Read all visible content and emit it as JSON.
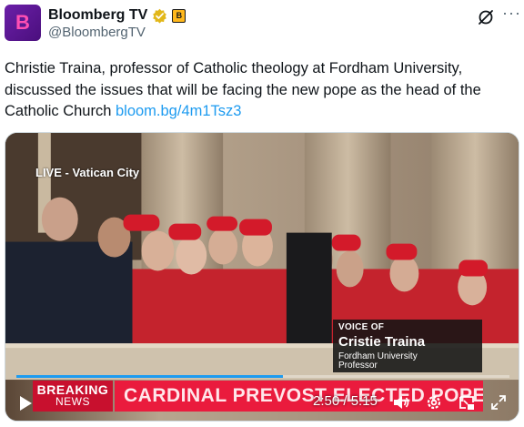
{
  "account": {
    "avatar_letter": "B",
    "display_name": "Bloomberg TV",
    "handle": "@BloombergTV",
    "affiliate_badge": "B",
    "brand_color": "#6b1fa8"
  },
  "tweet": {
    "text": "Christie Traina, professor of Catholic theology at Fordham University, discussed the issues that will be facing the new pope as the head of the Catholic Church ",
    "link": "bloom.bg/4m1Tsz3"
  },
  "video": {
    "live_label": "LIVE - Vatican City",
    "voice_of": "VOICE OF",
    "voice_name": "Cristie Traina",
    "voice_title_line1": "Fordham University",
    "voice_title_line2": "Professor",
    "breaking_line1": "BREAKING",
    "breaking_line2": "NEWS",
    "headline": "CARDINAL PREVOST ELECTED POPE",
    "time": "2:50 / 5:15",
    "progress": 0.54
  },
  "icons": {
    "verified": "verified-gold-check-icon",
    "grok": "grok-icon",
    "more": "more-dots-icon",
    "play": "play-icon",
    "volume": "volume-icon",
    "settings": "settings-gear-icon",
    "pip": "picture-in-picture-icon",
    "fullscreen": "fullscreen-icon"
  }
}
